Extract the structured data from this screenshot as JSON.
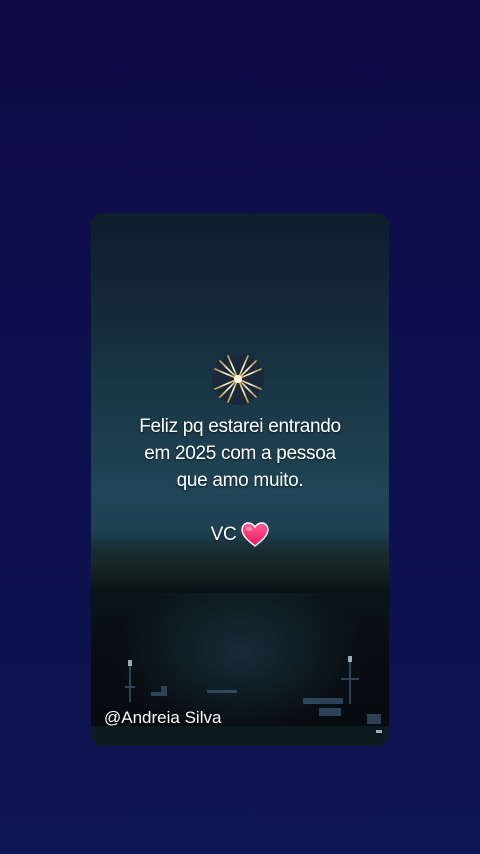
{
  "story": {
    "message_lines": [
      "Feliz pq estarei entrando",
      "em 2025 com a pessoa",
      "que amo muito."
    ],
    "closing_text": "VC",
    "emoji_top": "fireworks-icon",
    "emoji_end": "heart-icon",
    "author_handle": "@Andreia Silva"
  },
  "colors": {
    "page_background": "#0d0c44",
    "heart": "#ff3d7f",
    "text": "#ffffff"
  }
}
